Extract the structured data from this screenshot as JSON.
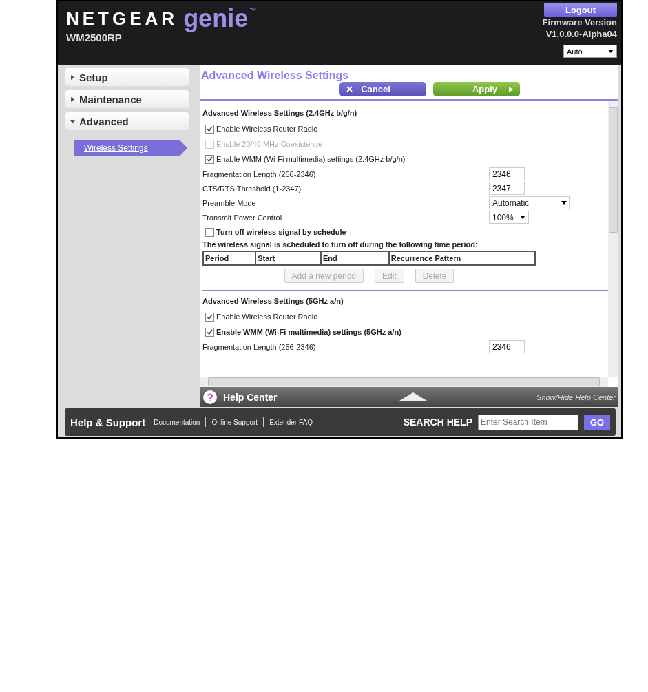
{
  "header": {
    "brand": "NETGEAR",
    "product": "genie",
    "trademark": "™",
    "model": "WM2500RP",
    "logout": "Logout",
    "firmware_label": "Firmware Version",
    "firmware_version": "V1.0.0.0-Alpha04",
    "language": "Auto"
  },
  "sidebar": {
    "items": [
      {
        "label": "Setup",
        "expanded": false
      },
      {
        "label": "Maintenance",
        "expanded": false
      },
      {
        "label": "Advanced",
        "expanded": true,
        "children": [
          {
            "label": "Wireless Settings",
            "selected": true
          }
        ]
      }
    ]
  },
  "content": {
    "title": "Advanced Wireless Settings",
    "buttons": [
      {
        "kind": "cancel",
        "label": "Cancel"
      },
      {
        "kind": "apply",
        "label": "Apply"
      }
    ],
    "sections": [
      {
        "heading": "Advanced Wireless Settings (2.4GHz b/g/n)",
        "rows": [
          {
            "kind": "checkbox",
            "label": "Enable Wireless Router Radio",
            "checked": true,
            "disabled": false,
            "bold": false
          },
          {
            "kind": "checkbox",
            "label": "Enable 20/40 MHz Coexistence",
            "checked": false,
            "disabled": true,
            "bold": false
          },
          {
            "kind": "checkbox",
            "label": "Enable WMM (Wi-Fi multimedia) settings (2.4GHz b/g/n)",
            "checked": true,
            "disabled": false,
            "bold": false
          },
          {
            "kind": "input",
            "label": "Fragmentation Length (256-2346)",
            "value": "2346"
          },
          {
            "kind": "input",
            "label": "CTS/RTS Threshold (1-2347)",
            "value": "2347"
          },
          {
            "kind": "select",
            "label": "Preamble Mode",
            "value": "Automatic",
            "wide": true
          },
          {
            "kind": "select",
            "label": "Transmit Power Control",
            "value": "100%",
            "wide": false
          },
          {
            "kind": "checkbox",
            "label": "Turn off wireless signal by schedule",
            "checked": false,
            "disabled": false,
            "bold": true
          }
        ],
        "schedule": {
          "text": "The wireless signal is scheduled to turn off during the following time period:",
          "columns": [
            "Period",
            "Start",
            "End",
            "Recurrence Pattern"
          ],
          "buttons": [
            {
              "label": "Add a new period",
              "disabled": true
            },
            {
              "label": "Edit",
              "disabled": true
            },
            {
              "label": "Delete",
              "disabled": true
            }
          ]
        }
      },
      {
        "heading": "Advanced Wireless Settings (5GHz a/n)",
        "rows": [
          {
            "kind": "checkbox",
            "label": "Enable Wireless Router Radio",
            "checked": true,
            "disabled": false,
            "bold": false
          },
          {
            "kind": "checkbox",
            "label": "Enable WMM (Wi-Fi multimedia) settings (5GHz a/n)",
            "checked": true,
            "disabled": false,
            "bold": true
          },
          {
            "kind": "input",
            "label": "Fragmentation Length (256-2346)",
            "value": "2346"
          }
        ]
      }
    ]
  },
  "help_center": {
    "title": "Help Center",
    "link": "Show/Hide Help Center"
  },
  "footer": {
    "title": "Help & Support",
    "links": [
      "Documentation",
      "Online Support",
      "Extender FAQ"
    ],
    "search_label": "SEARCH HELP",
    "search_placeholder": "Enter Search Item",
    "go": "GO"
  }
}
